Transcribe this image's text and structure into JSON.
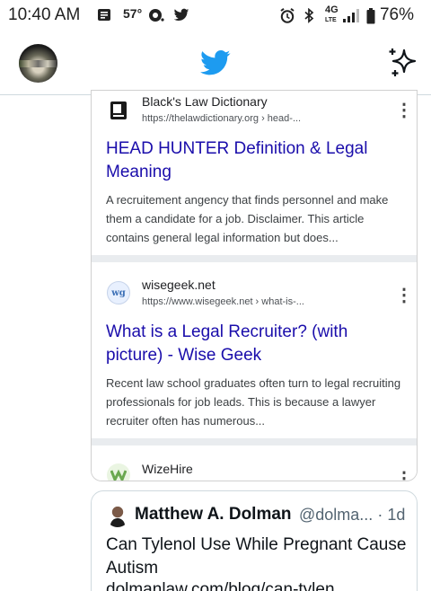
{
  "status_bar": {
    "time": "10:40 AM",
    "temperature": "57°",
    "network": "4G",
    "network_sub": "LTE",
    "battery": "76%"
  },
  "header": {
    "logo_icon": "twitter-bird-icon",
    "sparkle_icon": "sparkle-icon",
    "brand_color": "#1d9bf0"
  },
  "card": {
    "results": [
      {
        "site": "Black's Law Dictionary",
        "url": "https://thelawdictionary.org › head-...",
        "title": "HEAD HUNTER Definition & Legal Meaning",
        "snippet": "A recruitement angency that finds personnel and make them a candidate for a job. Disclaimer. This article contains general legal information but does..."
      },
      {
        "site": "wisegeek.net",
        "url": "https://www.wisegeek.net › what-is-...",
        "title": "What is a Legal Recruiter? (with picture) - Wise Geek",
        "snippet": "Recent law school graduates often turn to legal recruiting professionals for job leads. This is because a lawyer recruiter often has numerous..."
      },
      {
        "site": "WizeHire"
      }
    ],
    "colors": {
      "link": "#1a0dab",
      "separator": "#e9ecef"
    }
  },
  "tweet": {
    "name": "Matthew A. Dolman",
    "handle": "@dolma...",
    "time": "· 1d",
    "text": "Can Tylenol Use While Pregnant Cause Autism",
    "link": "dolmanlaw.com/blog/can-tylen..."
  }
}
